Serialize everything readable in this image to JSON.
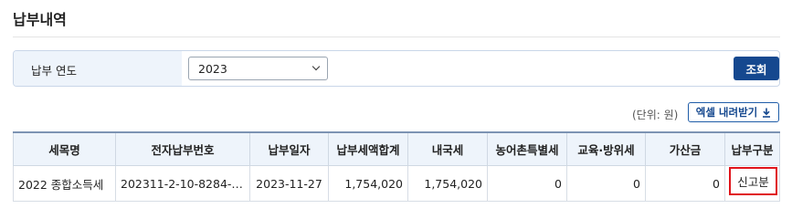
{
  "page": {
    "title": "납부내역"
  },
  "search": {
    "label": "납부 연도",
    "year_value": "2023",
    "search_button": "조회"
  },
  "toolbar": {
    "unit_text": "(단위: 원)",
    "excel_button": "엑셀 내려받기"
  },
  "table": {
    "headers": [
      "세목명",
      "전자납부번호",
      "납부일자",
      "납부세액합계",
      "내국세",
      "농어촌특별세",
      "교육·방위세",
      "가산금",
      "납부구분"
    ],
    "rows": [
      {
        "tax_item": "2022 종합소득세",
        "payment_no": "202311-2-10-8284-…",
        "payment_date": "2023-11-27",
        "total": "1,754,020",
        "national_tax": "1,754,020",
        "rural_special_tax": "0",
        "education_defense_tax": "0",
        "penalty": "0",
        "payment_type": "신고분"
      }
    ]
  },
  "colors": {
    "primary_button": "#15488f",
    "highlight_box": "#e0141b",
    "label_bg": "#eef4fb"
  },
  "icons": {
    "select": "chevron-down-icon",
    "excel": "download-icon"
  }
}
